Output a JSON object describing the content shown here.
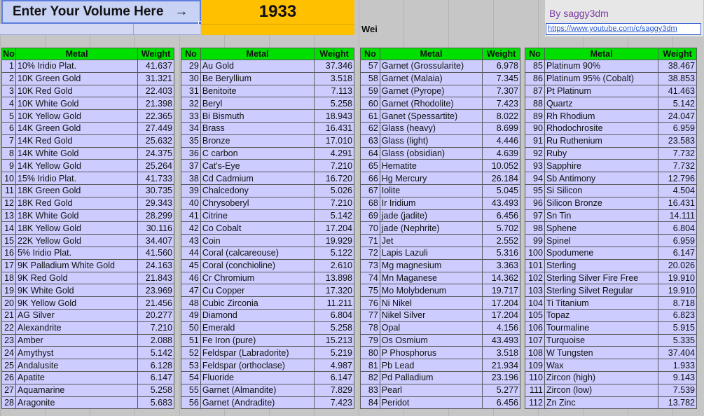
{
  "header": {
    "enter_label": "Enter Your Volume Here",
    "arrow": "→",
    "volume": "1933",
    "weight_label_cut": "Wei",
    "author": "By saggy3dm",
    "link": "https://www.youtube.com/c/saggy3dm"
  },
  "columns": {
    "no": "No",
    "metal": "Metal",
    "weight": "Weight"
  },
  "tables": [
    [
      {
        "no": "1",
        "metal": "10% Iridio Plat.",
        "weight": "41.637"
      },
      {
        "no": "2",
        "metal": "10K Green Gold",
        "weight": "31.321"
      },
      {
        "no": "3",
        "metal": "10K Red Gold",
        "weight": "22.403"
      },
      {
        "no": "4",
        "metal": "10K White Gold",
        "weight": "21.398"
      },
      {
        "no": "5",
        "metal": "10K Yellow Gold",
        "weight": "22.365"
      },
      {
        "no": "6",
        "metal": "14K Green Gold",
        "weight": "27.449"
      },
      {
        "no": "7",
        "metal": "14K Red Gold",
        "weight": "25.632"
      },
      {
        "no": "8",
        "metal": "14K White Gold",
        "weight": "24.375"
      },
      {
        "no": "9",
        "metal": "14K Yellow Gold",
        "weight": "25.264"
      },
      {
        "no": "10",
        "metal": "15% Iridio Plat.",
        "weight": "41.733"
      },
      {
        "no": "11",
        "metal": "18K Green Gold",
        "weight": "30.735"
      },
      {
        "no": "12",
        "metal": "18K Red Gold",
        "weight": "29.343"
      },
      {
        "no": "13",
        "metal": "18K White Gold",
        "weight": "28.299"
      },
      {
        "no": "14",
        "metal": "18K Yellow Gold",
        "weight": "30.116"
      },
      {
        "no": "15",
        "metal": "22K Yellow Gold",
        "weight": "34.407"
      },
      {
        "no": "16",
        "metal": "5% Iridio Plat.",
        "weight": "41.560"
      },
      {
        "no": "17",
        "metal": "9K Palladium White Gold",
        "weight": "24.163"
      },
      {
        "no": "18",
        "metal": "9K Red Gold",
        "weight": "21.843"
      },
      {
        "no": "19",
        "metal": "9K White Gold",
        "weight": "23.969"
      },
      {
        "no": "20",
        "metal": "9K Yellow Gold",
        "weight": "21.456"
      },
      {
        "no": "21",
        "metal": "AG Silver",
        "weight": "20.277"
      },
      {
        "no": "22",
        "metal": "Alexandrite",
        "weight": "7.210"
      },
      {
        "no": "23",
        "metal": "Amber",
        "weight": "2.088"
      },
      {
        "no": "24",
        "metal": "Amythyst",
        "weight": "5.142"
      },
      {
        "no": "25",
        "metal": "Andalusite",
        "weight": "6.128"
      },
      {
        "no": "26",
        "metal": "Apatite",
        "weight": "6.147"
      },
      {
        "no": "27",
        "metal": "Aquamarine",
        "weight": "5.258"
      },
      {
        "no": "28",
        "metal": "Aragonite",
        "weight": "5.683"
      }
    ],
    [
      {
        "no": "29",
        "metal": "Au Gold",
        "weight": "37.346"
      },
      {
        "no": "30",
        "metal": "Be Beryllium",
        "weight": "3.518"
      },
      {
        "no": "31",
        "metal": "Benitoite",
        "weight": "7.113"
      },
      {
        "no": "32",
        "metal": "Beryl",
        "weight": "5.258"
      },
      {
        "no": "33",
        "metal": "Bi Bismuth",
        "weight": "18.943"
      },
      {
        "no": "34",
        "metal": "Brass",
        "weight": "16.431"
      },
      {
        "no": "35",
        "metal": "Bronze",
        "weight": "17.010"
      },
      {
        "no": "36",
        "metal": "C carbon",
        "weight": "4.291"
      },
      {
        "no": "37",
        "metal": "Cat's-Eye",
        "weight": "7.210"
      },
      {
        "no": "38",
        "metal": "Cd Cadmium",
        "weight": "16.720"
      },
      {
        "no": "39",
        "metal": "Chalcedony",
        "weight": "5.026"
      },
      {
        "no": "40",
        "metal": "Chrysoberyl",
        "weight": "7.210"
      },
      {
        "no": "41",
        "metal": "Citrine",
        "weight": "5.142"
      },
      {
        "no": "42",
        "metal": "Co Cobalt",
        "weight": "17.204"
      },
      {
        "no": "43",
        "metal": "Coin",
        "weight": "19.929"
      },
      {
        "no": "44",
        "metal": "Coral (calcareouse)",
        "weight": "5.122"
      },
      {
        "no": "45",
        "metal": "Coral (conchioline)",
        "weight": "2.610"
      },
      {
        "no": "46",
        "metal": "Cr Chromium",
        "weight": "13.898"
      },
      {
        "no": "47",
        "metal": "Cu Copper",
        "weight": "17.320"
      },
      {
        "no": "48",
        "metal": "Cubic Zirconia",
        "weight": "11.211"
      },
      {
        "no": "49",
        "metal": "Diamond",
        "weight": "6.804"
      },
      {
        "no": "50",
        "metal": "Emerald",
        "weight": "5.258"
      },
      {
        "no": "51",
        "metal": "Fe Iron (pure)",
        "weight": "15.213"
      },
      {
        "no": "52",
        "metal": "Feldspar (Labradorite)",
        "weight": "5.219"
      },
      {
        "no": "53",
        "metal": "Feldspar (orthoclase)",
        "weight": "4.987"
      },
      {
        "no": "54",
        "metal": "Fluoride",
        "weight": "6.147"
      },
      {
        "no": "55",
        "metal": "Garnet (Almandite)",
        "weight": "7.829"
      },
      {
        "no": "56",
        "metal": "Garnet (Andradite)",
        "weight": "7.423"
      }
    ],
    [
      {
        "no": "57",
        "metal": "Garnet (Grossularite)",
        "weight": "6.978"
      },
      {
        "no": "58",
        "metal": "Garnet (Malaia)",
        "weight": "7.345"
      },
      {
        "no": "59",
        "metal": "Garnet (Pyrope)",
        "weight": "7.307"
      },
      {
        "no": "60",
        "metal": "Garnet (Rhodolite)",
        "weight": "7.423"
      },
      {
        "no": "61",
        "metal": "Ganet (Spessartite)",
        "weight": "8.022"
      },
      {
        "no": "62",
        "metal": "Glass (heavy)",
        "weight": "8.699"
      },
      {
        "no": "63",
        "metal": "Glass (light)",
        "weight": "4.446"
      },
      {
        "no": "64",
        "metal": "Glass (obsidian)",
        "weight": "4.639"
      },
      {
        "no": "65",
        "metal": "Hematite",
        "weight": "10.052"
      },
      {
        "no": "66",
        "metal": "Hg Mercury",
        "weight": "26.184"
      },
      {
        "no": "67",
        "metal": "Iolite",
        "weight": "5.045"
      },
      {
        "no": "68",
        "metal": "Ir Iridium",
        "weight": "43.493"
      },
      {
        "no": "69",
        "metal": "jade (jadite)",
        "weight": "6.456"
      },
      {
        "no": "70",
        "metal": "jade (Nephrite)",
        "weight": "5.702"
      },
      {
        "no": "71",
        "metal": "Jet",
        "weight": "2.552"
      },
      {
        "no": "72",
        "metal": "Lapis Lazuli",
        "weight": "5.316"
      },
      {
        "no": "73",
        "metal": "Mg magnesium",
        "weight": "3.363"
      },
      {
        "no": "74",
        "metal": "Mn Maganese",
        "weight": "14.362"
      },
      {
        "no": "75",
        "metal": "Mo Molybdenum",
        "weight": "19.717"
      },
      {
        "no": "76",
        "metal": "Ni Nikel",
        "weight": "17.204"
      },
      {
        "no": "77",
        "metal": "Nikel Silver",
        "weight": "17.204"
      },
      {
        "no": "78",
        "metal": "Opal",
        "weight": "4.156"
      },
      {
        "no": "79",
        "metal": "Os Osmium",
        "weight": "43.493"
      },
      {
        "no": "80",
        "metal": "P Phosphorus",
        "weight": "3.518"
      },
      {
        "no": "81",
        "metal": "Pb Lead",
        "weight": "21.934"
      },
      {
        "no": "82",
        "metal": "Pd Palladium",
        "weight": "23.196"
      },
      {
        "no": "83",
        "metal": "Pearl",
        "weight": "5.277"
      },
      {
        "no": "84",
        "metal": "Peridot",
        "weight": "6.456"
      }
    ],
    [
      {
        "no": "85",
        "metal": "Platinum 90%",
        "weight": "38.467"
      },
      {
        "no": "86",
        "metal": "Platinum 95% (Cobalt)",
        "weight": "38.853"
      },
      {
        "no": "87",
        "metal": "Pt Platinum",
        "weight": "41.463"
      },
      {
        "no": "88",
        "metal": "Quartz",
        "weight": "5.142"
      },
      {
        "no": "89",
        "metal": "Rh Rhodium",
        "weight": "24.047"
      },
      {
        "no": "90",
        "metal": "Rhodochrosite",
        "weight": "6.959"
      },
      {
        "no": "91",
        "metal": "Ru Ruthenium",
        "weight": "23.583"
      },
      {
        "no": "92",
        "metal": "Ruby",
        "weight": "7.732"
      },
      {
        "no": "93",
        "metal": "Sapphire",
        "weight": "7.732"
      },
      {
        "no": "94",
        "metal": "Sb Antimony",
        "weight": "12.796"
      },
      {
        "no": "95",
        "metal": "Si Silicon",
        "weight": "4.504"
      },
      {
        "no": "96",
        "metal": "Silicon Bronze",
        "weight": "16.431"
      },
      {
        "no": "97",
        "metal": "Sn Tin",
        "weight": "14.111"
      },
      {
        "no": "98",
        "metal": "Sphene",
        "weight": "6.804"
      },
      {
        "no": "99",
        "metal": "Spinel",
        "weight": "6.959"
      },
      {
        "no": "100",
        "metal": "Spodumene",
        "weight": "6.147"
      },
      {
        "no": "101",
        "metal": "Sterling",
        "weight": "20.026"
      },
      {
        "no": "102",
        "metal": "Sterling Silver Fire Free",
        "weight": "19.910"
      },
      {
        "no": "103",
        "metal": "Sterling Silvet Regular",
        "weight": "19.910"
      },
      {
        "no": "104",
        "metal": "Ti Titanium",
        "weight": "8.718"
      },
      {
        "no": "105",
        "metal": "Topaz",
        "weight": "6.823"
      },
      {
        "no": "106",
        "metal": "Tourmaline",
        "weight": "5.915"
      },
      {
        "no": "107",
        "metal": "Turquoise",
        "weight": "5.335"
      },
      {
        "no": "108",
        "metal": "W Tungsten",
        "weight": "37.404"
      },
      {
        "no": "109",
        "metal": "Wax",
        "weight": "1.933"
      },
      {
        "no": "110",
        "metal": "Zircon (high)",
        "weight": "9.143"
      },
      {
        "no": "111",
        "metal": "Zircon (low)",
        "weight": "7.539"
      },
      {
        "no": "112",
        "metal": "Zn Zinc",
        "weight": "13.782"
      }
    ]
  ]
}
